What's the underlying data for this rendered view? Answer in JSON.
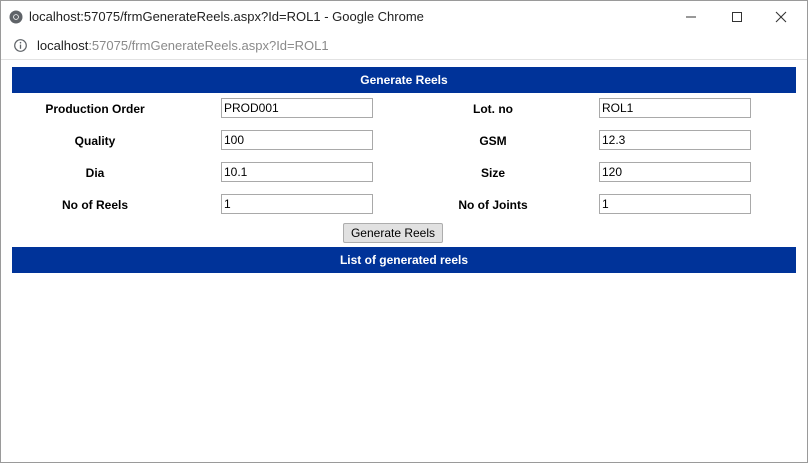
{
  "window": {
    "title": "localhost:57075/frmGenerateReels.aspx?Id=ROL1 - Google Chrome",
    "controls": {
      "minimize": "–",
      "maximize": "☐",
      "close": "✕"
    }
  },
  "address": {
    "host": "localhost",
    "path": ":57075/frmGenerateReels.aspx?Id=ROL1"
  },
  "form": {
    "header": "Generate Reels",
    "fields": {
      "production_order": {
        "label": "Production Order",
        "value": "PROD001"
      },
      "lot_no": {
        "label": "Lot. no",
        "value": "ROL1"
      },
      "quality": {
        "label": "Quality",
        "value": "100"
      },
      "gsm": {
        "label": "GSM",
        "value": "12.3"
      },
      "dia": {
        "label": "Dia",
        "value": "10.1"
      },
      "size": {
        "label": "Size",
        "value": "120"
      },
      "no_of_reels": {
        "label": "No of Reels",
        "value": "1"
      },
      "no_of_joints": {
        "label": "No of Joints",
        "value": "1"
      }
    },
    "generate_button": "Generate Reels",
    "list_header": "List of generated reels"
  },
  "colors": {
    "band": "#003399",
    "band_text": "#ffffff"
  },
  "icons": {
    "chrome": "chrome-icon",
    "info": "info-icon"
  }
}
